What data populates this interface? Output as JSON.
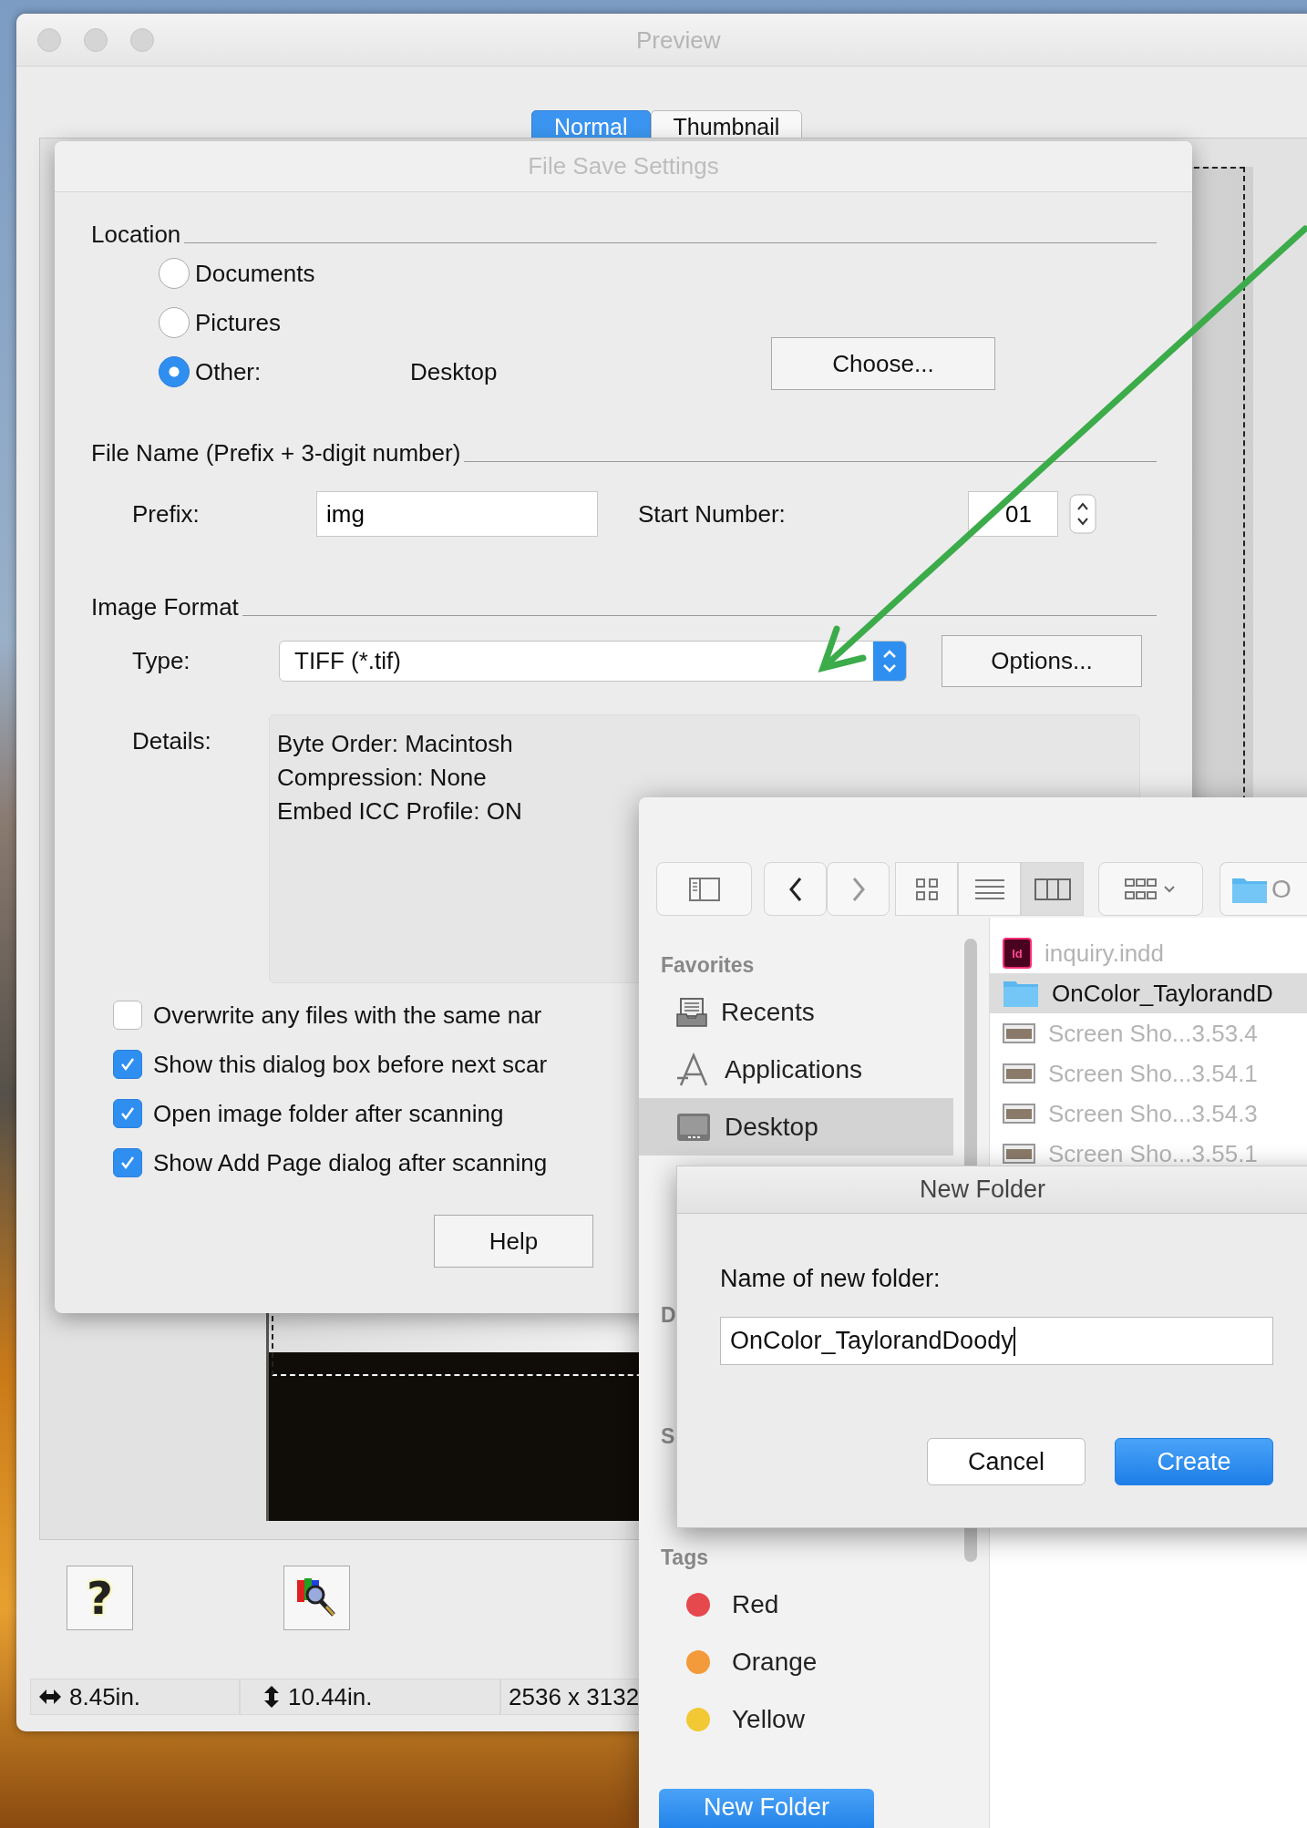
{
  "preview_window": {
    "title": "Preview",
    "tabs": [
      {
        "label": "Normal",
        "selected": true
      },
      {
        "label": "Thumbnail",
        "selected": false
      }
    ],
    "help_glyph": "?",
    "status_bar": {
      "width": "8.45in.",
      "height": "10.44in.",
      "pixels": "2536 x 3132"
    }
  },
  "file_save_settings": {
    "title": "File Save Settings",
    "location": {
      "heading": "Location",
      "options": [
        {
          "label": "Documents",
          "selected": false
        },
        {
          "label": "Pictures",
          "selected": false
        },
        {
          "label": "Other:",
          "selected": true
        }
      ],
      "other_path": "Desktop",
      "choose_button": "Choose..."
    },
    "file_name": {
      "heading": "File Name (Prefix + 3-digit number)",
      "prefix_label": "Prefix:",
      "prefix_value": "img",
      "start_number_label": "Start Number:",
      "start_number_value": "01"
    },
    "image_format": {
      "heading": "Image Format",
      "type_label": "Type:",
      "type_value": "TIFF (*.tif)",
      "options_button": "Options...",
      "details_label": "Details:",
      "details": [
        "Byte Order: Macintosh",
        "Compression: None",
        "Embed ICC Profile: ON"
      ]
    },
    "checkboxes": [
      {
        "label": "Overwrite any files with the same nar",
        "checked": false
      },
      {
        "label": "Show this dialog box before next scar",
        "checked": true
      },
      {
        "label": "Open image folder after scanning",
        "checked": true
      },
      {
        "label": "Show Add Page dialog after scanning",
        "checked": true
      }
    ],
    "help_button": "Help"
  },
  "save_panel": {
    "path_popup": "O",
    "sidebar": [
      {
        "heading": "Favorites",
        "items": [
          {
            "label": "Recents",
            "kind": "recents",
            "selected": false
          },
          {
            "label": "Applications",
            "kind": "applications",
            "selected": false
          },
          {
            "label": "Desktop",
            "kind": "desktop",
            "selected": true
          }
        ]
      },
      {
        "heading": "D"
      },
      {
        "heading": "S"
      },
      {
        "heading": "Tags",
        "items": [
          {
            "label": "Red",
            "kind": "tag",
            "color": "#e5484d"
          },
          {
            "label": "Orange",
            "kind": "tag",
            "color": "#f39a3a"
          },
          {
            "label": "Yellow",
            "kind": "tag",
            "color": "#f2c935"
          }
        ]
      }
    ],
    "files": [
      {
        "name": "inquiry.indd",
        "kind": "indesign",
        "badge": "Id",
        "enabled": false,
        "selected": false
      },
      {
        "name": "OnColor_TaylorandD",
        "kind": "folder",
        "enabled": true,
        "selected": true
      },
      {
        "name": "Screen Sho...3.53.4",
        "kind": "image",
        "enabled": false,
        "selected": false
      },
      {
        "name": "Screen Sho...3.54.1",
        "kind": "image",
        "enabled": false,
        "selected": false
      },
      {
        "name": "Screen Sho...3.54.3",
        "kind": "image",
        "enabled": false,
        "selected": false
      },
      {
        "name": "Screen Sho...3.55.1",
        "kind": "image",
        "enabled": false,
        "selected": false
      }
    ],
    "new_folder_button": "New Folder"
  },
  "new_folder_sheet": {
    "title": "New Folder",
    "prompt": "Name of new folder:",
    "value": "OnColor_TaylorandDoody",
    "buttons": [
      {
        "label": "Cancel",
        "kind": "secondary"
      },
      {
        "label": "Create",
        "kind": "default"
      }
    ]
  }
}
